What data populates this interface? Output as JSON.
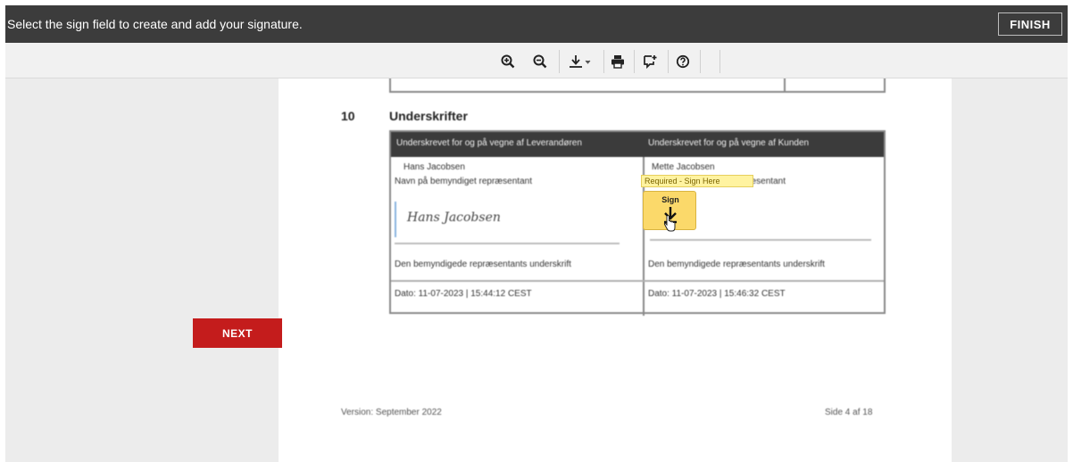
{
  "topbar": {
    "message": "Select the sign field to create and add your signature.",
    "finish_label": "FINISH"
  },
  "toolbar": {
    "items": [
      {
        "name": "zoom-in-icon",
        "glyph": "+"
      },
      {
        "name": "zoom-out-icon",
        "glyph": "−"
      },
      {
        "name": "download-icon",
        "glyph": "⤓"
      },
      {
        "name": "print-icon",
        "glyph": "▬"
      },
      {
        "name": "comment-icon",
        "glyph": "✚"
      },
      {
        "name": "help-icon",
        "glyph": "?"
      }
    ]
  },
  "navigation": {
    "next_label": "NEXT"
  },
  "document": {
    "section_number": "10",
    "section_title": "Underskrifter",
    "supplier_header": "Underskrevet for og på vegne af Leverandøren",
    "customer_header": "Underskrevet for og på vegne af Kunden",
    "supplier_name": "Hans Jacobsen",
    "customer_name": "Mette Jacobsen",
    "name_caption_left": "Navn på bemyndiget repræsentant",
    "name_caption_right": "Navn på bemyndiget repræsentant",
    "signature_left": "Hans Jacobsen",
    "signature_caption_left": "Den bemyndigede repræsentants underskrift",
    "signature_caption_right": "Den bemyndigede repræsentants underskrift",
    "date_left": "Dato: 11-07-2023 | 15:44:12 CEST",
    "date_right": "Dato: 11-07-2023 | 15:46:32 CEST",
    "tooltip": "Required - Sign Here",
    "sign_label": "Sign",
    "footer_left": "Version: September 2022",
    "footer_right": "Side 4 af 18"
  },
  "colors": {
    "topbar": "#3c3c3c",
    "next_button": "#c41c1c",
    "sign_field": "#fbd96a",
    "tooltip": "#fff3a0"
  }
}
